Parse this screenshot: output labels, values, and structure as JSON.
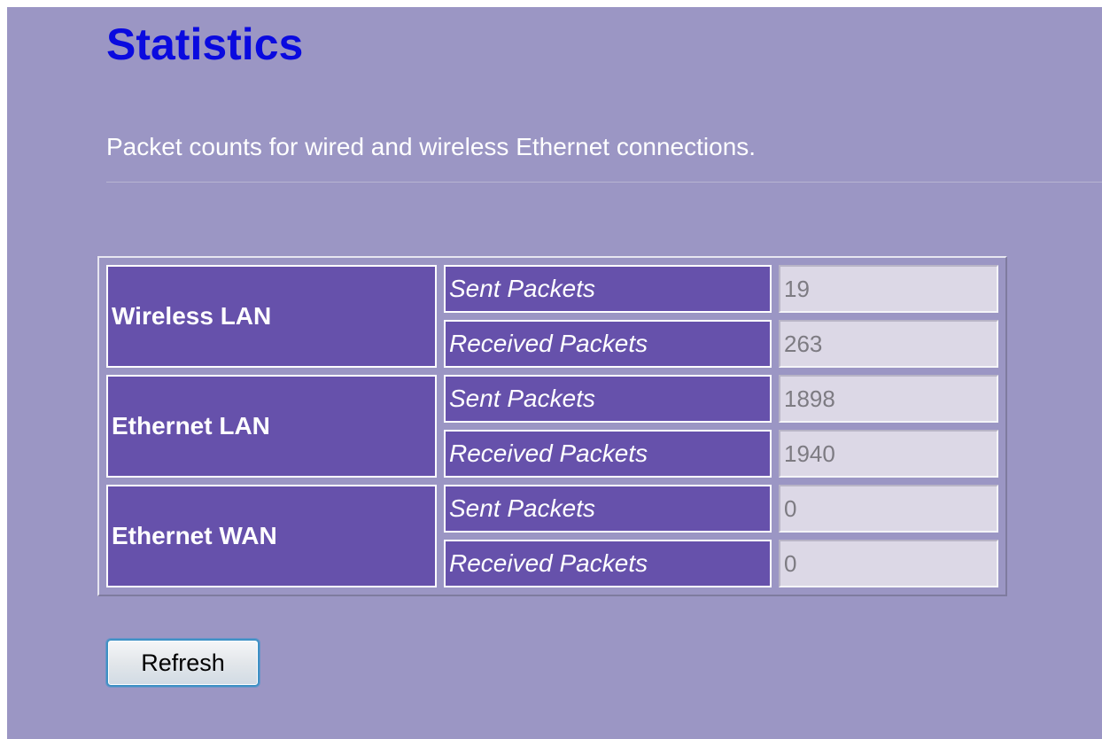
{
  "page": {
    "title": "Statistics",
    "description": "Packet counts for wired and wireless Ethernet connections."
  },
  "colors": {
    "page_background": "#9b96c4",
    "title_text": "#0a0adf",
    "header_cell": "#6651ab",
    "value_cell": "#dcd8e6",
    "value_text": "#7d7b82"
  },
  "stats": {
    "wireless_lan": {
      "label": "Wireless LAN",
      "sent_label": "Sent Packets",
      "sent_value": "19",
      "received_label": "Received Packets",
      "received_value": "263"
    },
    "ethernet_lan": {
      "label": "Ethernet LAN",
      "sent_label": "Sent Packets",
      "sent_value": "1898",
      "received_label": "Received Packets",
      "received_value": "1940"
    },
    "ethernet_wan": {
      "label": "Ethernet WAN",
      "sent_label": "Sent Packets",
      "sent_value": "0",
      "received_label": "Received Packets",
      "received_value": "0"
    }
  },
  "actions": {
    "refresh_label": "Refresh"
  }
}
